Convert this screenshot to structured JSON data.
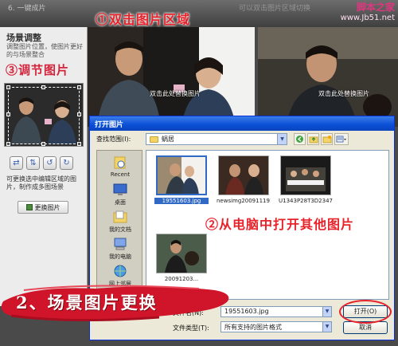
{
  "top": {
    "title_left": "6. 一键成片",
    "title_right": "可以双击图片区域切换"
  },
  "watermark": {
    "line1": "脚本之家",
    "line2": "www.Jb51.net"
  },
  "annotations": {
    "step1": "①双击图片区域",
    "step2": "②从电脑中打开其他图片",
    "step3": "③调节图片",
    "banner": "2、场景图片更换"
  },
  "left_panel": {
    "title": "场景调整",
    "description": "调整图片位置，使图片更好的与场景整合",
    "tip": "可更换选中编辑区域的图片，制作成多图场景",
    "replace_button": "更换图片"
  },
  "scenes": {
    "left_hint": "双击此处替换图片",
    "right_hint": "双击此处替换图片"
  },
  "dialog": {
    "title": "打开图片",
    "look_in_label": "查找范围(I):",
    "look_in_value": "蜗居",
    "places": [
      "Recent",
      "桌面",
      "我的文档",
      "我的电脑",
      "网上邻居"
    ],
    "files": [
      "19551603.jpg",
      "newsimg2009111911...",
      "U1343P28T3D234703...",
      "20091203..."
    ],
    "file_name_label": "文件名(N):",
    "file_name_value": "19551603.jpg",
    "file_type_label": "文件类型(T):",
    "file_type_value": "所有支持的图片格式",
    "open_button": "打开(O)",
    "cancel_button": "取消"
  },
  "colors": {
    "annotation_red": "#e8222a",
    "dialog_title_blue": "#0a4fd6",
    "panel_bg": "#ececec"
  }
}
